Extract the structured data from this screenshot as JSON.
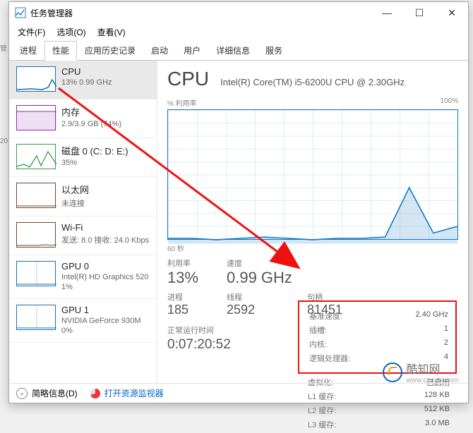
{
  "window": {
    "title": "任务管理器",
    "menus": [
      "文件(F)",
      "选项(O)",
      "查看(V)"
    ],
    "tabs": [
      "进程",
      "性能",
      "应用历史记录",
      "启动",
      "用户",
      "详细信息",
      "服务"
    ],
    "active_tab_index": 1
  },
  "sidebar": {
    "items": [
      {
        "title": "CPU",
        "sub": "13% 0.99 GHz",
        "kind": "cpu",
        "selected": true
      },
      {
        "title": "内存",
        "sub": "2.9/3.9 GB (74%)",
        "kind": "mem"
      },
      {
        "title": "磁盘 0 (C: D: E:)",
        "sub": "35%",
        "kind": "disk"
      },
      {
        "title": "以太网",
        "sub": "未连接",
        "kind": "eth"
      },
      {
        "title": "Wi-Fi",
        "sub": "发送: 8.0 接收: 24.0 Kbps",
        "kind": "wifi"
      },
      {
        "title": "GPU 0",
        "sub": "Intel(R) HD Graphics 520",
        "sub2": "1%",
        "kind": "gpu"
      },
      {
        "title": "GPU 1",
        "sub": "NVIDIA GeForce 930M",
        "sub2": "0%",
        "kind": "gpu"
      }
    ]
  },
  "detail": {
    "header": "CPU",
    "model": "Intel(R) Core(TM) i5-6200U CPU @ 2.30GHz",
    "chart_label_left": "% 利用率",
    "chart_label_right": "100%",
    "chart_label_bottom": "60 秒",
    "stats_labels": {
      "util": "利用率",
      "speed": "速度",
      "procs": "进程",
      "threads": "线程",
      "handles": "句柄"
    },
    "stats": {
      "util": "13%",
      "speed": "0.99 GHz",
      "procs": "185",
      "threads": "2592",
      "handles": "81451"
    },
    "uptime_label": "正常运行时间",
    "uptime": "0:07:20:52"
  },
  "info": {
    "rows": [
      {
        "k": "基准速度:",
        "v": "2.40 GHz"
      },
      {
        "k": "插槽:",
        "v": "1"
      },
      {
        "k": "内核:",
        "v": "2"
      },
      {
        "k": "逻辑处理器:",
        "v": "4"
      }
    ],
    "below": [
      {
        "k": "虚拟化:",
        "v": "已启用"
      },
      {
        "k": "L1 缓存:",
        "v": "128 KB"
      },
      {
        "k": "L2 缓存:",
        "v": "512 KB"
      },
      {
        "k": "L3 缓存:",
        "v": "3.0 MB"
      }
    ]
  },
  "footer": {
    "brief": "简略信息(D)",
    "open_resmon": "打开资源监视器"
  },
  "watermark": {
    "brand": "酷知网",
    "url": "www.coozhi.com"
  },
  "chart_data": {
    "type": "line",
    "title": "% 利用率",
    "xlabel": "60 秒",
    "ylabel": "%",
    "ylim": [
      0,
      100
    ],
    "x_seconds": [
      60,
      55,
      50,
      45,
      40,
      35,
      30,
      25,
      20,
      15,
      10,
      5,
      0
    ],
    "values": [
      4,
      4,
      3,
      4,
      5,
      4,
      3,
      4,
      4,
      5,
      42,
      8,
      13
    ]
  }
}
